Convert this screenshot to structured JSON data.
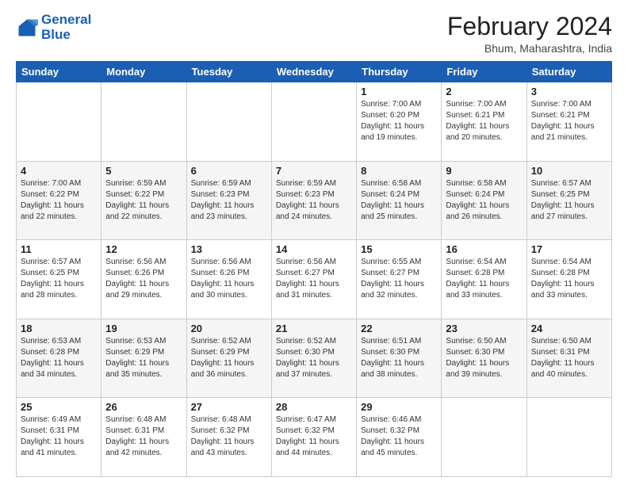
{
  "logo": {
    "general": "General",
    "blue": "Blue"
  },
  "header": {
    "title": "February 2024",
    "subtitle": "Bhum, Maharashtra, India"
  },
  "weekdays": [
    "Sunday",
    "Monday",
    "Tuesday",
    "Wednesday",
    "Thursday",
    "Friday",
    "Saturday"
  ],
  "weeks": [
    [
      {
        "day": "",
        "info": ""
      },
      {
        "day": "",
        "info": ""
      },
      {
        "day": "",
        "info": ""
      },
      {
        "day": "",
        "info": ""
      },
      {
        "day": "1",
        "info": "Sunrise: 7:00 AM\nSunset: 6:20 PM\nDaylight: 11 hours and 19 minutes."
      },
      {
        "day": "2",
        "info": "Sunrise: 7:00 AM\nSunset: 6:21 PM\nDaylight: 11 hours and 20 minutes."
      },
      {
        "day": "3",
        "info": "Sunrise: 7:00 AM\nSunset: 6:21 PM\nDaylight: 11 hours and 21 minutes."
      }
    ],
    [
      {
        "day": "4",
        "info": "Sunrise: 7:00 AM\nSunset: 6:22 PM\nDaylight: 11 hours and 22 minutes."
      },
      {
        "day": "5",
        "info": "Sunrise: 6:59 AM\nSunset: 6:22 PM\nDaylight: 11 hours and 22 minutes."
      },
      {
        "day": "6",
        "info": "Sunrise: 6:59 AM\nSunset: 6:23 PM\nDaylight: 11 hours and 23 minutes."
      },
      {
        "day": "7",
        "info": "Sunrise: 6:59 AM\nSunset: 6:23 PM\nDaylight: 11 hours and 24 minutes."
      },
      {
        "day": "8",
        "info": "Sunrise: 6:58 AM\nSunset: 6:24 PM\nDaylight: 11 hours and 25 minutes."
      },
      {
        "day": "9",
        "info": "Sunrise: 6:58 AM\nSunset: 6:24 PM\nDaylight: 11 hours and 26 minutes."
      },
      {
        "day": "10",
        "info": "Sunrise: 6:57 AM\nSunset: 6:25 PM\nDaylight: 11 hours and 27 minutes."
      }
    ],
    [
      {
        "day": "11",
        "info": "Sunrise: 6:57 AM\nSunset: 6:25 PM\nDaylight: 11 hours and 28 minutes."
      },
      {
        "day": "12",
        "info": "Sunrise: 6:56 AM\nSunset: 6:26 PM\nDaylight: 11 hours and 29 minutes."
      },
      {
        "day": "13",
        "info": "Sunrise: 6:56 AM\nSunset: 6:26 PM\nDaylight: 11 hours and 30 minutes."
      },
      {
        "day": "14",
        "info": "Sunrise: 6:56 AM\nSunset: 6:27 PM\nDaylight: 11 hours and 31 minutes."
      },
      {
        "day": "15",
        "info": "Sunrise: 6:55 AM\nSunset: 6:27 PM\nDaylight: 11 hours and 32 minutes."
      },
      {
        "day": "16",
        "info": "Sunrise: 6:54 AM\nSunset: 6:28 PM\nDaylight: 11 hours and 33 minutes."
      },
      {
        "day": "17",
        "info": "Sunrise: 6:54 AM\nSunset: 6:28 PM\nDaylight: 11 hours and 33 minutes."
      }
    ],
    [
      {
        "day": "18",
        "info": "Sunrise: 6:53 AM\nSunset: 6:28 PM\nDaylight: 11 hours and 34 minutes."
      },
      {
        "day": "19",
        "info": "Sunrise: 6:53 AM\nSunset: 6:29 PM\nDaylight: 11 hours and 35 minutes."
      },
      {
        "day": "20",
        "info": "Sunrise: 6:52 AM\nSunset: 6:29 PM\nDaylight: 11 hours and 36 minutes."
      },
      {
        "day": "21",
        "info": "Sunrise: 6:52 AM\nSunset: 6:30 PM\nDaylight: 11 hours and 37 minutes."
      },
      {
        "day": "22",
        "info": "Sunrise: 6:51 AM\nSunset: 6:30 PM\nDaylight: 11 hours and 38 minutes."
      },
      {
        "day": "23",
        "info": "Sunrise: 6:50 AM\nSunset: 6:30 PM\nDaylight: 11 hours and 39 minutes."
      },
      {
        "day": "24",
        "info": "Sunrise: 6:50 AM\nSunset: 6:31 PM\nDaylight: 11 hours and 40 minutes."
      }
    ],
    [
      {
        "day": "25",
        "info": "Sunrise: 6:49 AM\nSunset: 6:31 PM\nDaylight: 11 hours and 41 minutes."
      },
      {
        "day": "26",
        "info": "Sunrise: 6:48 AM\nSunset: 6:31 PM\nDaylight: 11 hours and 42 minutes."
      },
      {
        "day": "27",
        "info": "Sunrise: 6:48 AM\nSunset: 6:32 PM\nDaylight: 11 hours and 43 minutes."
      },
      {
        "day": "28",
        "info": "Sunrise: 6:47 AM\nSunset: 6:32 PM\nDaylight: 11 hours and 44 minutes."
      },
      {
        "day": "29",
        "info": "Sunrise: 6:46 AM\nSunset: 6:32 PM\nDaylight: 11 hours and 45 minutes."
      },
      {
        "day": "",
        "info": ""
      },
      {
        "day": "",
        "info": ""
      }
    ]
  ]
}
